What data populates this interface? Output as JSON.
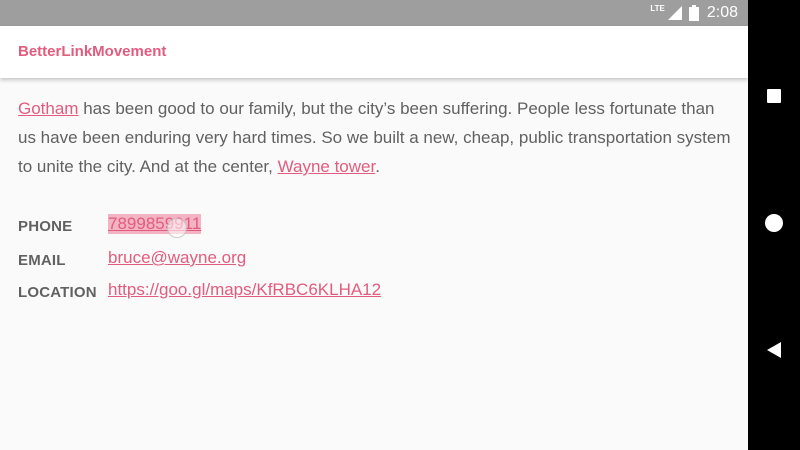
{
  "status_bar": {
    "network_label": "LTE",
    "time": "2:08",
    "icons": [
      "signal-icon",
      "battery-icon"
    ]
  },
  "app_bar": {
    "title": "BetterLinkMovement"
  },
  "content": {
    "paragraph": {
      "link1": "Gotham",
      "text1": " has been good to our family, but the city’s been suffering. People less fortunate than us have been enduring very hard times. So we built a new, cheap, public transportation system to unite the city. And at the center, ",
      "link2": "Wayne tower",
      "text2": "."
    },
    "info": [
      {
        "label": "PHONE",
        "value": "7899859911"
      },
      {
        "label": "EMAIL",
        "value": "bruce@wayne.org"
      },
      {
        "label": "LOCATION",
        "value": "https://goo.gl/maps/KfRBC6KLHA12"
      }
    ]
  },
  "nav_bar": {
    "buttons": [
      "recents-icon",
      "home-icon",
      "back-icon"
    ]
  },
  "colors": {
    "accent": "#e25c7e",
    "text": "#616161",
    "status_bar": "#9e9e9e",
    "nav_bar": "#000000",
    "highlight": "#ec7896"
  }
}
